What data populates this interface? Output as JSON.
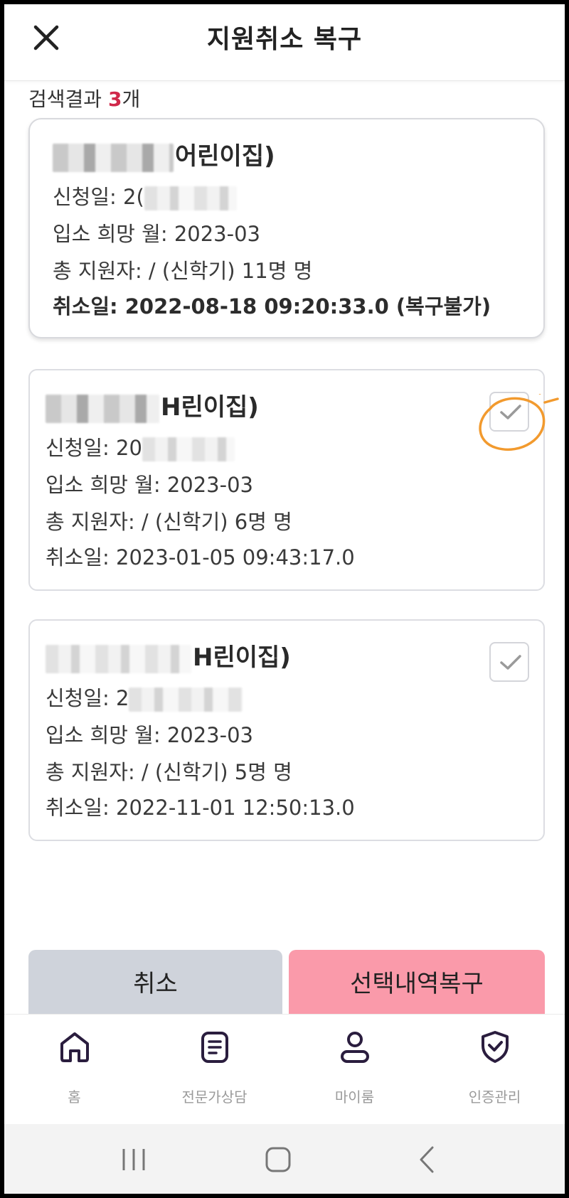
{
  "header": {
    "title": "지원취소 복구",
    "close_icon": "close-icon"
  },
  "results": {
    "label": "검색결과 ",
    "count": "3",
    "suffix": "개"
  },
  "cards": [
    {
      "name_suffix": "어린이집)",
      "applied_label": "신청일: 2(",
      "hope_month": "입소 희망 월: 2023-03",
      "applicants": "총 지원자: / (신학기) 11명 명",
      "cancel_date": "취소일: 2022-08-18 09:20:33.0 (복구불가)"
    },
    {
      "name_suffix": "H린이집)",
      "applied_label": "신청일: 20",
      "hope_month": "입소 희망 월: 2023-03",
      "applicants": "총 지원자: / (신학기) 6명 명",
      "cancel_date": "취소일: 2023-01-05 09:43:17.0"
    },
    {
      "name_suffix": "H린이집)",
      "applied_label": "신청일: 2",
      "hope_month": "입소 희망 월: 2023-03",
      "applicants": "총 지원자: / (신학기) 5명 명",
      "cancel_date": "취소일: 2022-11-01 12:50:13.0"
    }
  ],
  "actions": {
    "cancel_label": "취소",
    "restore_label": "선택내역복구"
  },
  "bottom_nav": [
    {
      "label": "홈",
      "icon": "home-icon"
    },
    {
      "label": "전문가상담",
      "icon": "document-icon"
    },
    {
      "label": "마이룸",
      "icon": "user-icon"
    },
    {
      "label": "인증관리",
      "icon": "shield-check-icon"
    }
  ],
  "colors": {
    "accent_count": "#d0284a",
    "restore_button": "#fa9aaa",
    "cancel_button": "#cfd3db",
    "annotation": "#f29a2e"
  }
}
